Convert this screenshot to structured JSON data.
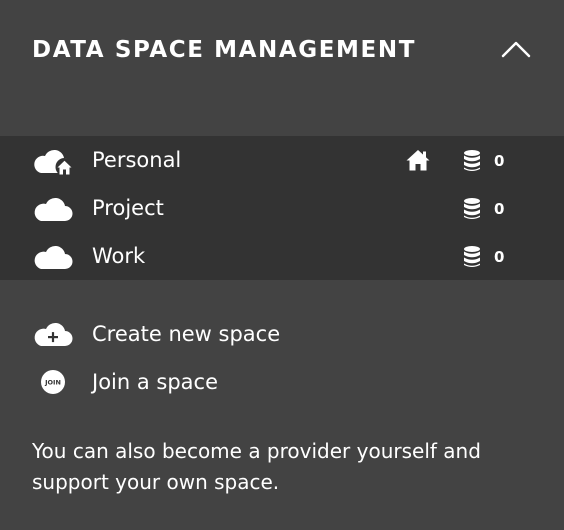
{
  "header": {
    "title": "DATA SPACE MANAGEMENT",
    "toggle_icon": "chevron-up-icon"
  },
  "spaces": [
    {
      "name": "Personal",
      "icon": "cloud-home-icon",
      "is_home": true,
      "provider_icon": "database-icon",
      "provider_count": "0"
    },
    {
      "name": "Project",
      "icon": "cloud-icon",
      "is_home": false,
      "provider_icon": "database-icon",
      "provider_count": "0"
    },
    {
      "name": "Work",
      "icon": "cloud-icon",
      "is_home": false,
      "provider_icon": "database-icon",
      "provider_count": "0"
    }
  ],
  "actions": {
    "create": {
      "label": "Create new space",
      "icon": "cloud-plus-icon"
    },
    "join": {
      "label": "Join a space",
      "icon": "join-icon",
      "badge_text": "JOIN"
    }
  },
  "note": "You can also become a provider yourself and support your own space.",
  "colors": {
    "panel_background": "#434343",
    "list_background": "#333333",
    "text": "#ffffff"
  }
}
